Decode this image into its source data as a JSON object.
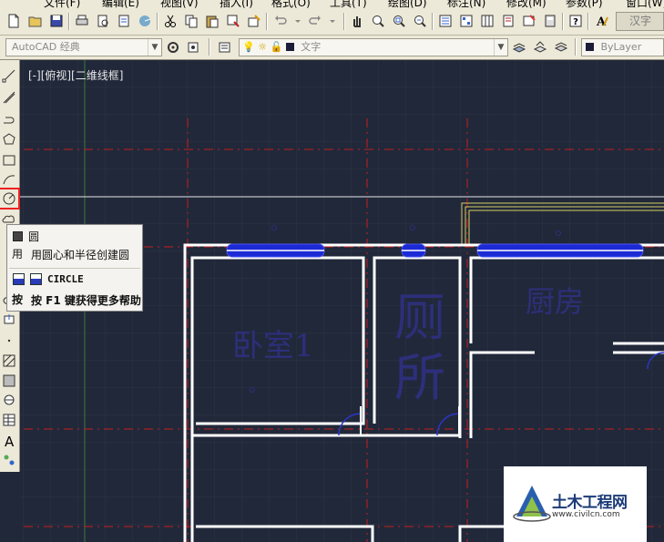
{
  "menu": [
    "文件(F)",
    "编辑(E)",
    "视图(V)",
    "插入(I)",
    "格式(O)",
    "工具(T)",
    "绘图(D)",
    "标注(N)",
    "修改(M)",
    "参数(P)",
    "窗口(W)"
  ],
  "ime_label": "汉字",
  "toolbar2": {
    "workspace": "AutoCAD 经典",
    "layer": "文字",
    "color": "ByLayer"
  },
  "viewport_label": "[-][俯视][二维线框]",
  "tooltip": {
    "title": "圆",
    "description": "用圆心和半径创建圆",
    "command": "CIRCLE",
    "help": "按 F1 键获得更多帮助",
    "left_overlap_1": "用",
    "left_overlap_2": "按"
  },
  "rooms": {
    "bedroom": "卧室1",
    "toilet_1": "厕",
    "toilet_2": "所",
    "kitchen": "厨房"
  },
  "watermark": {
    "name": "土木工程网",
    "url": "www.civilcn.com"
  },
  "colors": {
    "canvas": "#21283a",
    "wall": "#ffffff",
    "axis": "#c81e1e",
    "window": "#1c2ad6",
    "selection": "#e22222"
  }
}
